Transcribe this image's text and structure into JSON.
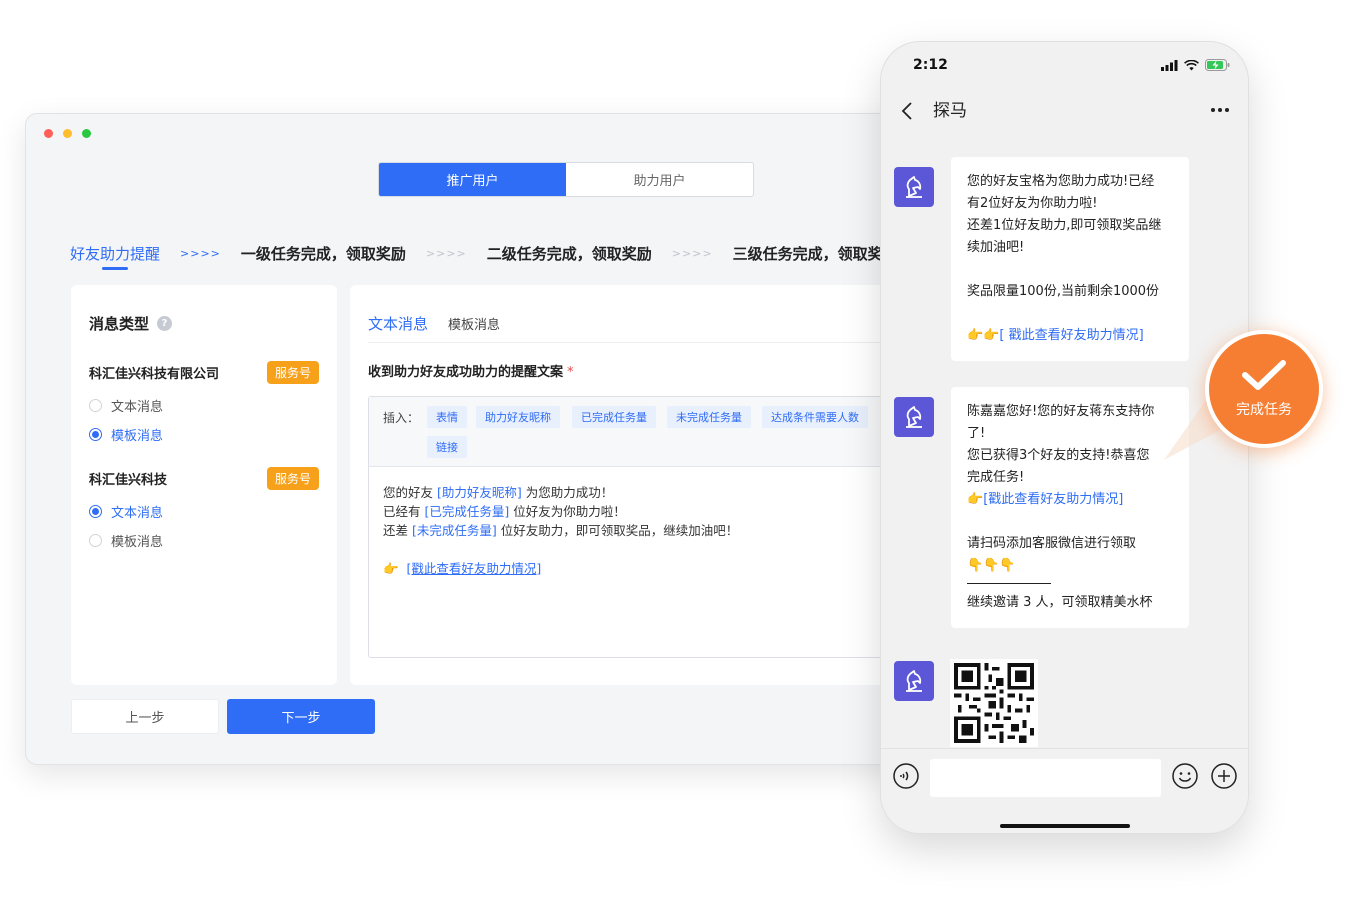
{
  "tabs": {
    "promote": "推广用户",
    "assist": "助力用户"
  },
  "steps": [
    {
      "label": "好友助力提醒"
    },
    {
      "label": "一级任务完成，领取奖励"
    },
    {
      "label": "二级任务完成，领取奖励"
    },
    {
      "label": "三级任务完成，领取奖励"
    }
  ],
  "step_arrow": ">>>>",
  "left_panel": {
    "title": "消息类型",
    "accounts": [
      {
        "name": "科汇佳兴科技有限公司",
        "badge": "服务号",
        "options": [
          "文本消息",
          "模板消息"
        ],
        "selected": 1
      },
      {
        "name": "科汇佳兴科技",
        "badge": "服务号",
        "options": [
          "文本消息",
          "模板消息"
        ],
        "selected": 0
      }
    ]
  },
  "buttons": {
    "prev": "上一步",
    "next": "下一步"
  },
  "right_panel": {
    "tab_text": "文本消息",
    "tab_template": "模板消息",
    "field_label": "收到助力好友成功助力的提醒文案",
    "required_mark": "*",
    "insert_label": "插入：",
    "insert_tokens": [
      "表情",
      "助力好友昵称",
      "已完成任务量",
      "未完成任务量",
      "达成条件需要人数",
      "链接"
    ],
    "content": {
      "l1_a": "您的好友 ",
      "l1_tok": "[助力好友昵称]",
      "l1_b": " 为您助力成功！",
      "l2_a": "已经有 ",
      "l2_tok": "[已完成任务量]",
      "l2_b": " 位好友为你助力啦！",
      "l3_a": "还差 ",
      "l3_tok": "[未完成任务量]",
      "l3_b": " 位好友助力，即可领取奖品，继续加油吧！",
      "link_emoji": "👉",
      "link": "[戳此查看好友助力情况]"
    }
  },
  "phone": {
    "time": "2:12",
    "chat_title": "探马",
    "msg1": {
      "l1": "您的好友宝格为您助力成功!已经",
      "l2": "有2位好友为你助力啦!",
      "l3": "还差1位好友助力,即可领取奖品继",
      "l4": "续加油吧!",
      "l5": "奖品限量100份,当前剩余1000份",
      "link_emoji": "👉👉",
      "link": "[ 戳此查看好友助力情况]"
    },
    "msg2": {
      "l1": "陈嘉嘉您好!您的好友蒋东支持你",
      "l2": "了!",
      "l3": "您已获得3个好友的支持!恭喜您",
      "l4": "完成任务!",
      "link_emoji": "👉",
      "link": "[戳此查看好友助力情况]",
      "l5": "请扫码添加客服微信进行领取",
      "l6": "👇👇👇",
      "l7": "继续邀请 3  人，可领取精美水杯"
    }
  },
  "complete_badge": "完成任务",
  "colors": {
    "primary": "#2f6df6",
    "badge": "#f7a11b",
    "complete": "#f57e32",
    "avatar": "#5b57d6"
  }
}
